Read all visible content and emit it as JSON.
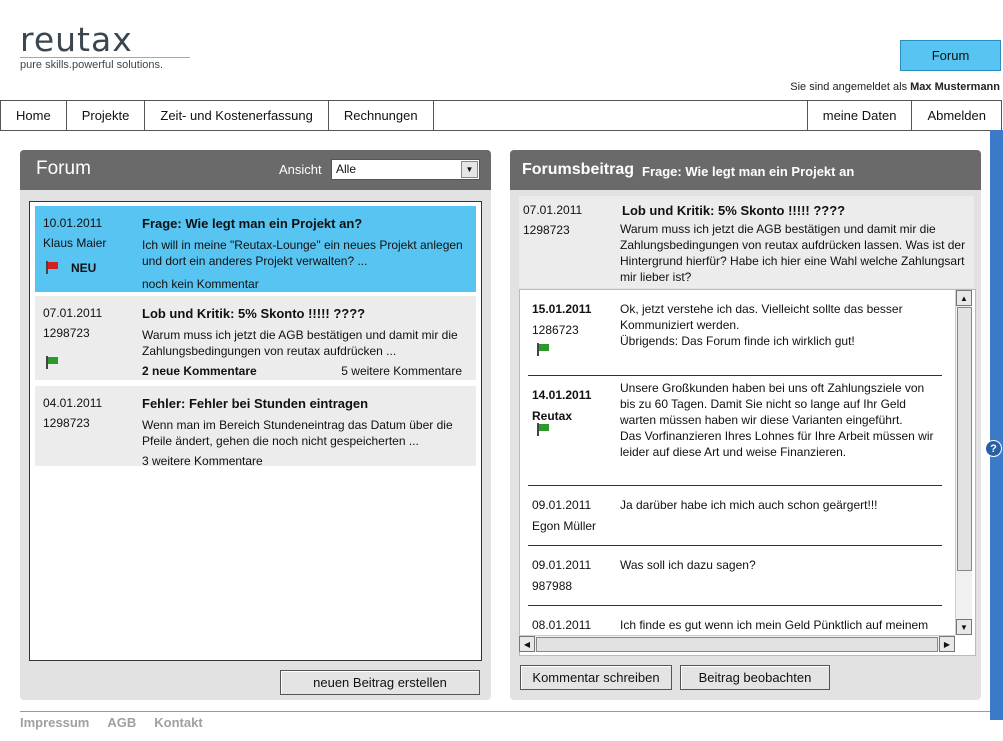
{
  "logo": {
    "wordmark": "reutax",
    "tagline": "pure skills.powerful solutions."
  },
  "header": {
    "forum_button": "Forum",
    "login_prefix": "Sie sind angemeldet als",
    "user_name": "Max Mustermann"
  },
  "nav": {
    "left": [
      "Home",
      "Projekte",
      "Zeit- und Kostenerfassung",
      "Rechnungen"
    ],
    "right": [
      "meine Daten",
      "Abmelden"
    ]
  },
  "forum": {
    "title": "Forum",
    "filter_label": "Ansicht",
    "filter_value": "Alle",
    "new_post_button": "neuen Beitrag erstellen",
    "posts": [
      {
        "date": "10.01.2011",
        "author": "Klaus Maier",
        "title": "Frage: Wie legt man ein Projekt an?",
        "body": "Ich will in meine \"Reutax-Lounge\" ein neues Projekt anlegen und dort ein anderes Projekt verwalten? ...",
        "badge": "NEU",
        "flag": "red",
        "footer_left": "noch kein Kommentar",
        "footer_right": "",
        "selected": true
      },
      {
        "date": "07.01.2011",
        "author": "1298723",
        "title": "Lob und Kritik: 5% Skonto !!!!! ????",
        "body": "Warum muss ich jetzt die AGB bestätigen und damit mir die Zahlungsbedingungen von reutax aufdrücken ...",
        "badge": "",
        "flag": "green",
        "footer_left": "2 neue Kommentare",
        "footer_right": "5 weitere Kommentare",
        "selected": false
      },
      {
        "date": "04.01.2011",
        "author": "1298723",
        "title": "Fehler: Fehler bei Stunden eintragen",
        "body": "Wenn man im Bereich Stundeneintrag das Datum über die Pfeile ändert, gehen die noch nicht gespeicherten ...",
        "badge": "",
        "flag": "",
        "footer_left": "3 weitere Kommentare",
        "footer_right": "",
        "selected": false
      }
    ]
  },
  "thread": {
    "title": "Forumsbeitrag",
    "subtitle": "Frage: Wie legt man ein Projekt an",
    "original": {
      "date": "07.01.2011",
      "author": "1298723",
      "title": "Lob und Kritik: 5% Skonto !!!!! ????",
      "body": "Warum muss ich jetzt die AGB bestätigen und damit mir die Zahlungsbedingungen von reutax aufdrücken lassen. Was ist der Hintergrund hierfür? Habe ich hier eine Wahl welche Zahlungsart mir lieber ist?"
    },
    "comments": [
      {
        "date": "15.01.2011",
        "author": "1286723",
        "bold": true,
        "flag": "green",
        "body": "Ok, jetzt verstehe ich das. Vielleicht sollte das besser Kommuniziert werden.\nÜbrigends: Das Forum finde ich wirklich gut!"
      },
      {
        "date": "14.01.2011",
        "author": "Reutax",
        "bold": true,
        "flag": "green",
        "body": "Unsere Großkunden haben bei uns oft Zahlungsziele von bis zu 60 Tagen. Damit Sie nicht so lange auf Ihr Geld warten müssen haben wir diese Varianten eingeführt.\nDas Vorfinanzieren Ihres Lohnes für Ihre Arbeit müssen wir leider auf diese Art und weise Finanzieren."
      },
      {
        "date": "09.01.2011",
        "author": "Egon Müller",
        "bold": false,
        "flag": "",
        "body": "Ja darüber habe ich mich auch schon geärgert!!!"
      },
      {
        "date": "09.01.2011",
        "author": "987988",
        "bold": false,
        "flag": "",
        "body": "Was soll ich dazu sagen?"
      },
      {
        "date": "08.01.2011",
        "author": "",
        "bold": false,
        "flag": "",
        "body": "Ich finde es gut wenn ich mein Geld Pünktlich auf meinem Konto habe."
      }
    ],
    "comment_button": "Kommentar schreiben",
    "watch_button": "Beitrag beobachten"
  },
  "help_label": "?",
  "footer": [
    "Impressum",
    "AGB",
    "Kontakt"
  ],
  "colors": {
    "accent": "#58c4f2",
    "panel_header": "#6a6a6a",
    "edge": "#3b79c9",
    "flag_red": "#d42020",
    "flag_green": "#2a9a2a"
  }
}
